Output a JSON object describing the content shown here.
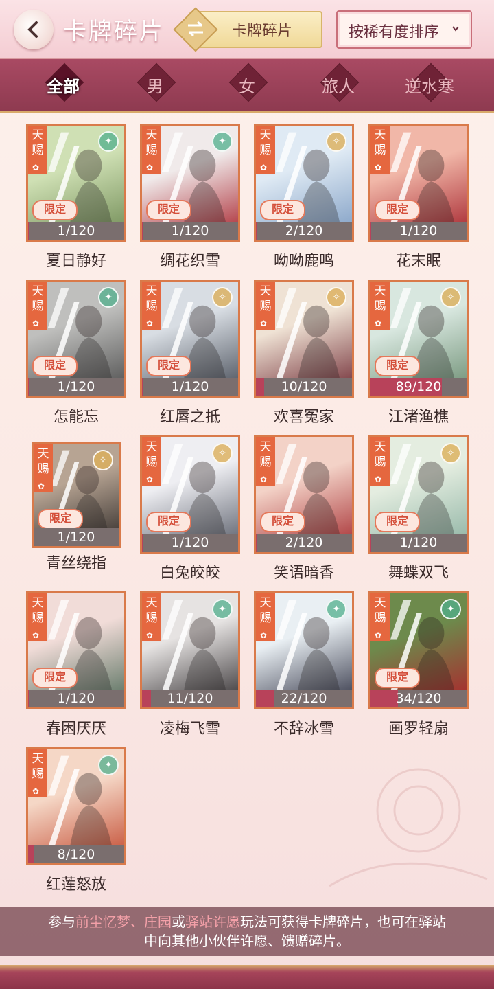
{
  "header": {
    "title": "卡牌碎片",
    "filter_label": "卡牌碎片",
    "sort_label": "按稀有度排序"
  },
  "categories": [
    {
      "label": "全部",
      "active": true
    },
    {
      "label": "男",
      "active": false
    },
    {
      "label": "女",
      "active": false
    },
    {
      "label": "旅人",
      "active": false
    },
    {
      "label": "逆水寒",
      "active": false
    }
  ],
  "card_labels": {
    "tianci_top": "天",
    "tianci_bottom": "赐",
    "limited": "限定"
  },
  "cards": [
    {
      "name": "夏日静好",
      "progress": "1/120",
      "fraction": 0.008,
      "limited": true,
      "badge": "jade",
      "art": [
        "#cfe0b4",
        "#6f8a54"
      ]
    },
    {
      "name": "绸花织雪",
      "progress": "1/120",
      "fraction": 0.008,
      "limited": true,
      "badge": "jade",
      "art": [
        "#f0eaea",
        "#a8222c"
      ]
    },
    {
      "name": "呦呦鹿鸣",
      "progress": "2/120",
      "fraction": 0.017,
      "limited": true,
      "badge": "gold",
      "art": [
        "#dfeaf4",
        "#7c9bc2"
      ]
    },
    {
      "name": "花末眠",
      "progress": "1/120",
      "fraction": 0.008,
      "limited": true,
      "badge": "none",
      "art": [
        "#f1b7a8",
        "#a3202a"
      ]
    },
    {
      "name": "怎能忘",
      "progress": "1/120",
      "fraction": 0.008,
      "limited": true,
      "badge": "jade",
      "art": [
        "#bfbfbd",
        "#4b4b4b"
      ]
    },
    {
      "name": "红唇之抵",
      "progress": "1/120",
      "fraction": 0.008,
      "limited": true,
      "badge": "gold",
      "art": [
        "#d8dde3",
        "#444a55"
      ]
    },
    {
      "name": "欢喜冤家",
      "progress": "10/120",
      "fraction": 0.083,
      "limited": false,
      "badge": "gold",
      "art": [
        "#efe2d4",
        "#6c2630"
      ]
    },
    {
      "name": "江渚渔樵",
      "progress": "89/120",
      "fraction": 0.742,
      "limited": true,
      "badge": "gold",
      "art": [
        "#d8e7df",
        "#6a8c70"
      ]
    },
    {
      "name": "青丝绕指",
      "progress": "1/120",
      "fraction": 0.008,
      "limited": true,
      "badge": "gold",
      "art": [
        "#b7a493",
        "#2f2a28"
      ],
      "small": true
    },
    {
      "name": "白兔皎皎",
      "progress": "1/120",
      "fraction": 0.008,
      "limited": true,
      "badge": "gold",
      "art": [
        "#eeeef2",
        "#555a66"
      ]
    },
    {
      "name": "笑语暗香",
      "progress": "2/120",
      "fraction": 0.017,
      "limited": true,
      "badge": "none",
      "art": [
        "#f3d2c7",
        "#a42a2e"
      ]
    },
    {
      "name": "舞蝶双飞",
      "progress": "1/120",
      "fraction": 0.008,
      "limited": true,
      "badge": "gold",
      "art": [
        "#e4ede0",
        "#8ab0a0"
      ]
    },
    {
      "name": "春困厌厌",
      "progress": "1/120",
      "fraction": 0.008,
      "limited": true,
      "badge": "none",
      "art": [
        "#f1dcd8",
        "#4e6a58"
      ]
    },
    {
      "name": "凌梅飞雪",
      "progress": "11/120",
      "fraction": 0.092,
      "limited": false,
      "badge": "jade",
      "art": [
        "#e6e3e2",
        "#2e2a2c"
      ]
    },
    {
      "name": "不辞冰雪",
      "progress": "22/120",
      "fraction": 0.183,
      "limited": false,
      "badge": "jade",
      "art": [
        "#e9eff3",
        "#2c2e40"
      ]
    },
    {
      "name": "画罗轻扇",
      "progress": "34/120",
      "fraction": 0.283,
      "limited": true,
      "badge": "jade",
      "art": [
        "#6d8a4c",
        "#b0202a"
      ]
    },
    {
      "name": "红莲怒放",
      "progress": "8/120",
      "fraction": 0.067,
      "limited": false,
      "badge": "jade",
      "art": [
        "#f5d7c6",
        "#c1462c"
      ]
    }
  ],
  "tip": {
    "prefix": "参与",
    "link1": "前尘忆梦",
    "sep1": "、",
    "link2": "庄园",
    "sep2": "或",
    "link3": "驿站许愿",
    "suffix_line1": "玩法可获得卡牌碎片，也可在驿站",
    "line2": "中向其他小伙伴许愿、馈赠碎片。"
  },
  "colors": {
    "accent": "#b8425a",
    "card_border": "#d97a4a",
    "category_bar": "#9c4259"
  }
}
